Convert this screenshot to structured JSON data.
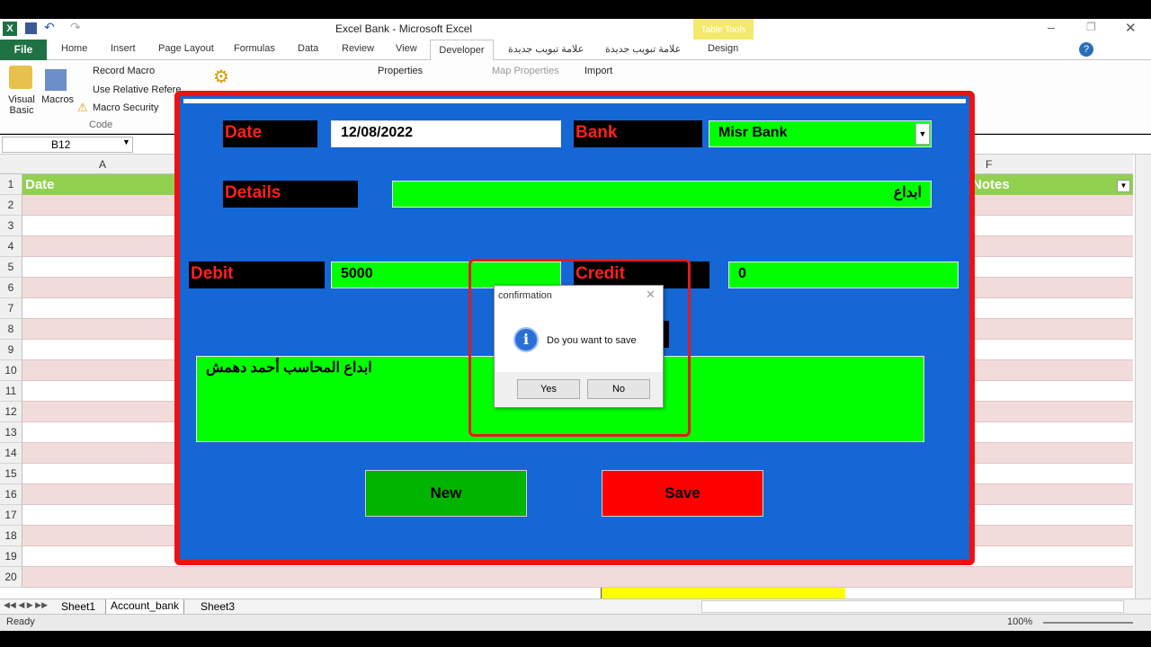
{
  "window": {
    "title": "Excel Bank  -  Microsoft Excel"
  },
  "ribbon": {
    "file_label": "File",
    "tabs": [
      "Home",
      "Insert",
      "Page Layout",
      "Formulas",
      "Data",
      "Review",
      "View",
      "Developer",
      "علامة تبويب جديدة",
      "علامة تبويب جديدة",
      "Design"
    ],
    "table_tools_label": "Table Tools",
    "code_group": {
      "visual_basic": "Visual Basic",
      "macros": "Macros",
      "record_macro": "Record Macro",
      "use_relative": "Use Relative Refere",
      "macro_security": "Macro Security",
      "group_label": "Code"
    },
    "properties": "Properties",
    "map_properties": "Map Properties",
    "import": "Import"
  },
  "formula_bar": {
    "name_box": "B12"
  },
  "sheet": {
    "col_a": "A",
    "col_f": "F",
    "header_date": "Date",
    "header_notes": "Notes",
    "rows": [
      "1",
      "2",
      "3",
      "4",
      "5",
      "6",
      "7",
      "8",
      "9",
      "10",
      "11",
      "12",
      "13",
      "14",
      "15",
      "16",
      "17",
      "18",
      "19",
      "20"
    ]
  },
  "sheet_tabs": [
    "Sheet1",
    "Account_bank",
    "Sheet3"
  ],
  "status": {
    "ready": "Ready",
    "zoom": "100%"
  },
  "userform": {
    "date_label": "Date",
    "date_value": "12/08/2022",
    "bank_label": "Bank",
    "bank_value": "Misr Bank",
    "details_label": "Details",
    "details_value": "ابداع",
    "debit_label": "Debit",
    "debit_value": "5000",
    "credit_label": "Credit",
    "credit_value": "0",
    "notes_value": "ابداع المحاسب أحمد دهمش",
    "new_button": "New",
    "save_button": "Save"
  },
  "dialog": {
    "title": "confirmation",
    "message": "Do you want to save",
    "yes": "Yes",
    "no": "No"
  },
  "colors": {
    "form_bg": "#1467d4",
    "form_border": "#ee1111",
    "field_bg": "#00ff00",
    "label_text": "#ff2020",
    "new_btn": "#00b400",
    "save_btn": "#ff0000"
  }
}
